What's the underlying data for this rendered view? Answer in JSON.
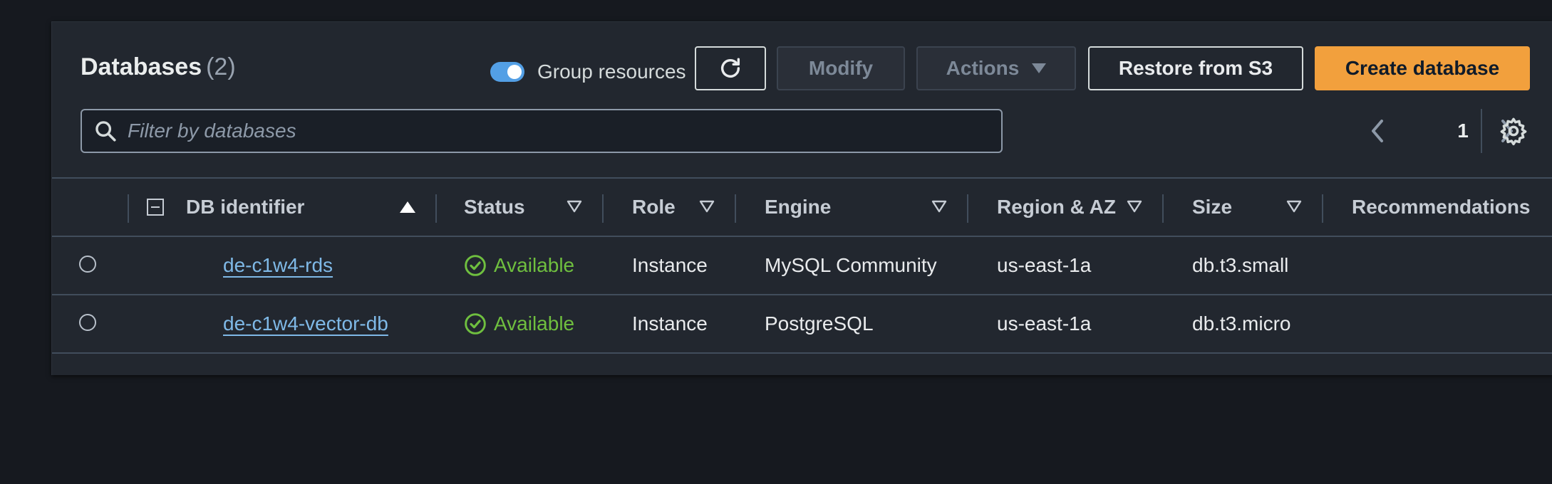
{
  "header": {
    "title": "Databases",
    "count": "(2)",
    "group_resources_label": "Group resources",
    "group_resources_on": true
  },
  "toolbar": {
    "refresh_icon": "refresh-icon",
    "modify_label": "Modify",
    "actions_label": "Actions",
    "restore_label": "Restore from S3",
    "create_label": "Create database"
  },
  "search": {
    "placeholder": "Filter by databases",
    "value": ""
  },
  "pagination": {
    "current_page": "1"
  },
  "table": {
    "columns": {
      "db_identifier": "DB identifier",
      "status": "Status",
      "role": "Role",
      "engine": "Engine",
      "region": "Region & AZ",
      "size": "Size",
      "recommendations": "Recommendations"
    },
    "rows": [
      {
        "identifier": "de-c1w4-rds",
        "status": "Available",
        "role": "Instance",
        "engine": "MySQL Community",
        "region": "us-east-1a",
        "size": "db.t3.small",
        "recommendations": ""
      },
      {
        "identifier": "de-c1w4-vector-db",
        "status": "Available",
        "role": "Instance",
        "engine": "PostgreSQL",
        "region": "us-east-1a",
        "size": "db.t3.micro",
        "recommendations": ""
      }
    ]
  },
  "colors": {
    "background": "#16191f",
    "panel": "#22272f",
    "primary_button": "#f2a03d",
    "toggle_on": "#539fe5",
    "link": "#7fb9e7",
    "status_available": "#6fbf3f"
  }
}
